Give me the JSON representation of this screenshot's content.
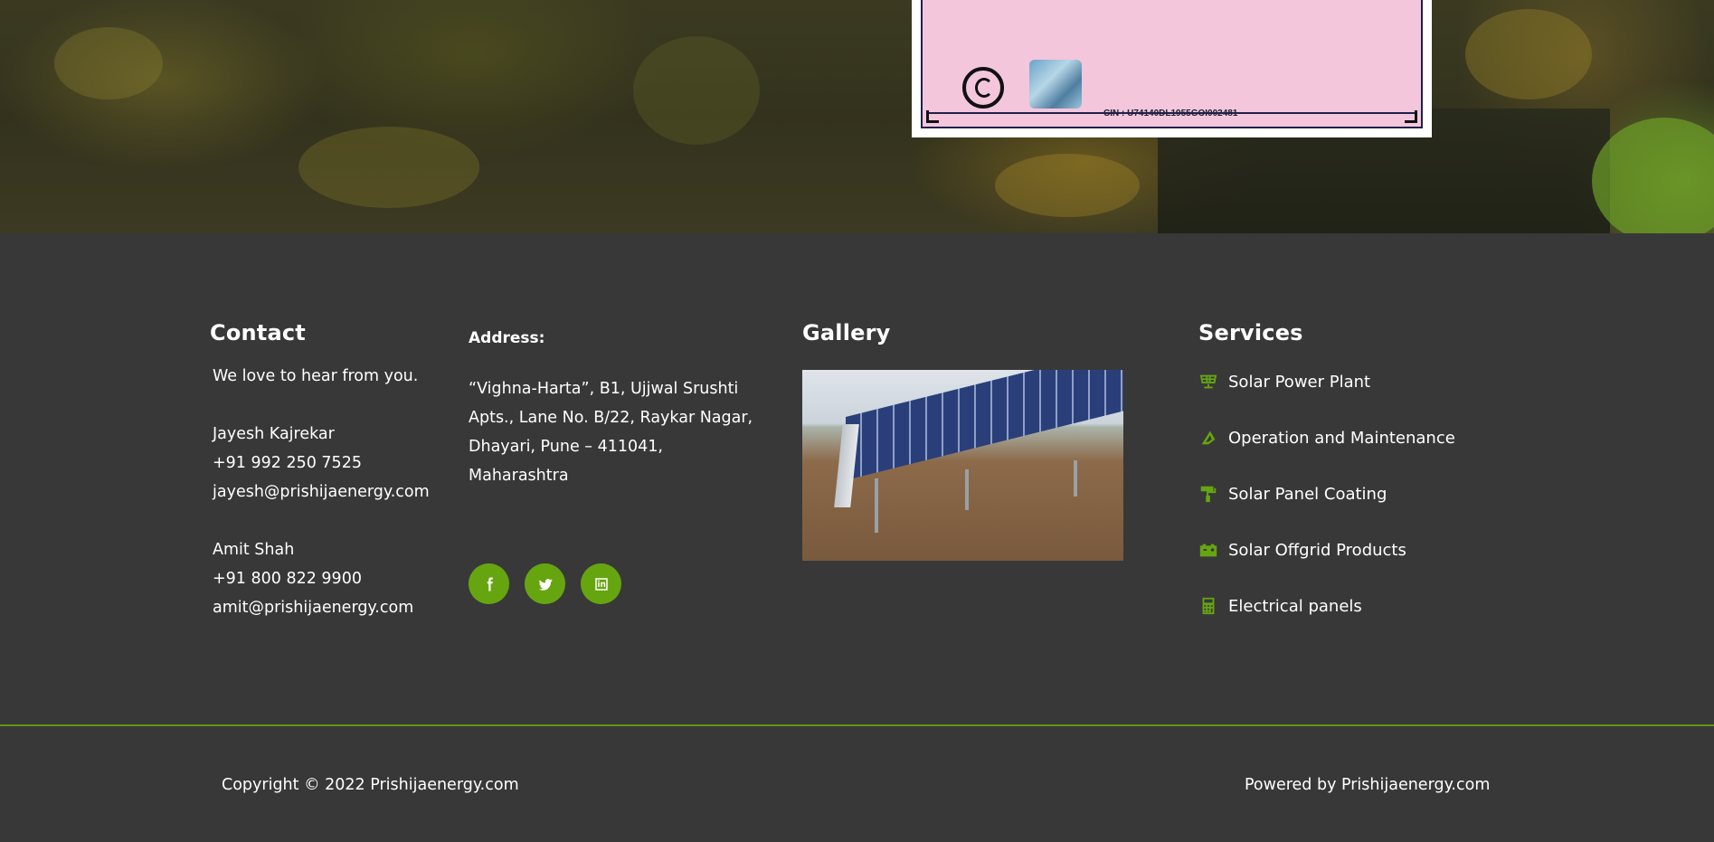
{
  "hero": {
    "certificate": {
      "cin_text": "CIN : U74140DL1955GOI002481"
    }
  },
  "contact": {
    "heading": "Contact",
    "tagline": "We love to hear from you.",
    "people": [
      {
        "name": "Jayesh Kajrekar",
        "phone": "+91 992 250 7525",
        "email": "jayesh@prishijaenergy.com"
      },
      {
        "name": "Amit Shah",
        "phone": "+91 800 822 9900",
        "email": "amit@prishijaenergy.com"
      }
    ]
  },
  "address": {
    "heading": "Address:",
    "lines": [
      "“Vighna-Harta”, B1, Ujjwal Srushti",
      "Apts., Lane No. B/22, Raykar Nagar,",
      "Dhayari, Pune – 411041,",
      "Maharashtra"
    ]
  },
  "socials": [
    {
      "name": "facebook",
      "icon": "facebook-icon"
    },
    {
      "name": "twitter",
      "icon": "twitter-icon"
    },
    {
      "name": "linkedin",
      "icon": "linkedin-icon"
    }
  ],
  "gallery": {
    "heading": "Gallery"
  },
  "services": {
    "heading": "Services",
    "items": [
      {
        "label": "Solar Power Plant",
        "icon": "solar-panel-icon"
      },
      {
        "label": "Operation and Maintenance",
        "icon": "solar-tilt-icon"
      },
      {
        "label": "Solar Panel Coating",
        "icon": "paint-roller-icon"
      },
      {
        "label": "Solar Offgrid Products",
        "icon": "car-battery-icon"
      },
      {
        "label": "Electrical panels",
        "icon": "calculator-icon"
      }
    ]
  },
  "bottom": {
    "copyright": "Copyright © 2022 Prishijaenergy.com",
    "powered": "Powered by Prishijaenergy.com"
  },
  "colors": {
    "footer_bg": "#383838",
    "accent": "#66a510",
    "text": "#ffffff"
  }
}
